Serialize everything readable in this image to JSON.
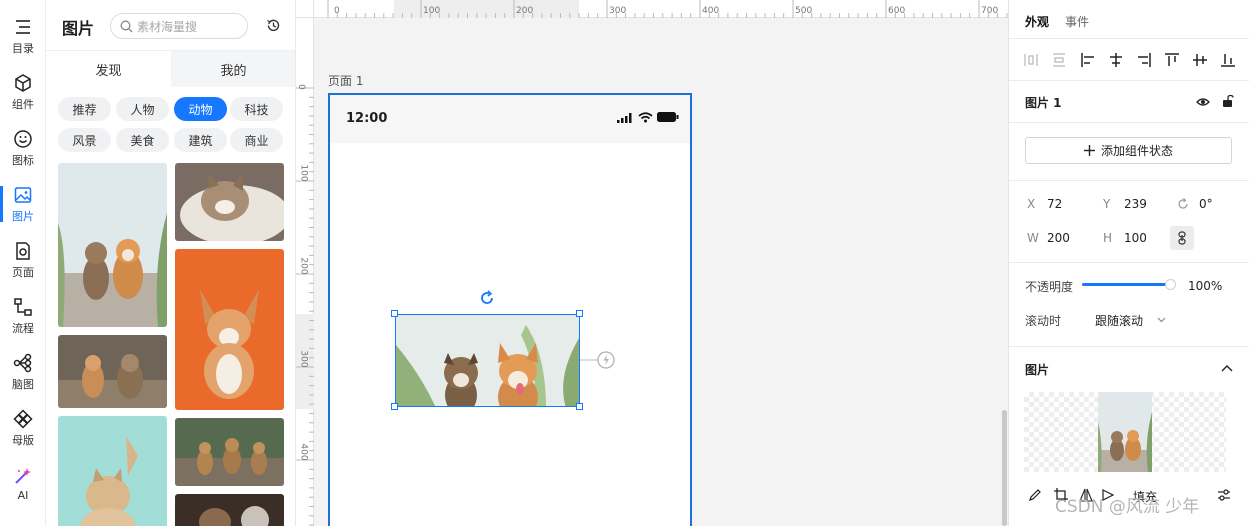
{
  "left_rail": [
    {
      "label": "目录",
      "icon": "list-icon"
    },
    {
      "label": "组件",
      "icon": "cube-icon"
    },
    {
      "label": "图标",
      "icon": "smile-icon"
    },
    {
      "label": "图片",
      "icon": "image-icon",
      "active": true
    },
    {
      "label": "页面",
      "icon": "page-icon"
    },
    {
      "label": "流程",
      "icon": "flow-icon"
    },
    {
      "label": "脑图",
      "icon": "mindmap-icon"
    },
    {
      "label": "母版",
      "icon": "master-icon"
    },
    {
      "label": "AI",
      "icon": "magic-wand-icon"
    }
  ],
  "panel": {
    "title": "图片",
    "search_placeholder": "素材海量搜",
    "tabs": [
      "发现",
      "我的"
    ],
    "active_tab": 0,
    "categories": [
      "推荐",
      "人物",
      "动物",
      "科技",
      "风景",
      "美食",
      "建筑",
      "商业"
    ],
    "active_category": "动物"
  },
  "canvas": {
    "ruler_top": [
      "0",
      "100",
      "200",
      "300",
      "400",
      "500",
      "600",
      "700"
    ],
    "ruler_left": [
      "0",
      "100",
      "200",
      "300",
      "400"
    ],
    "page_label": "页面 1",
    "status_time": "12:00"
  },
  "right_panel": {
    "tabs": [
      "外观",
      "事件"
    ],
    "layer_name": "图片 1",
    "add_state_label": "添加组件状态",
    "x_label": "X",
    "x": "72",
    "y_label": "Y",
    "y": "239",
    "rotation": "0°",
    "w_label": "W",
    "w": "200",
    "h_label": "H",
    "h": "100",
    "opacity_label": "不透明度",
    "opacity": "100%",
    "opacity_value": 1.0,
    "scroll_label": "滚动时",
    "scroll_value": "跟随滚动",
    "image_section": "图片",
    "fill_label": "填充"
  },
  "watermark": "CSDN @风流 少年",
  "colors": {
    "accent": "#1677ff",
    "selection": "#1f6fd8"
  }
}
